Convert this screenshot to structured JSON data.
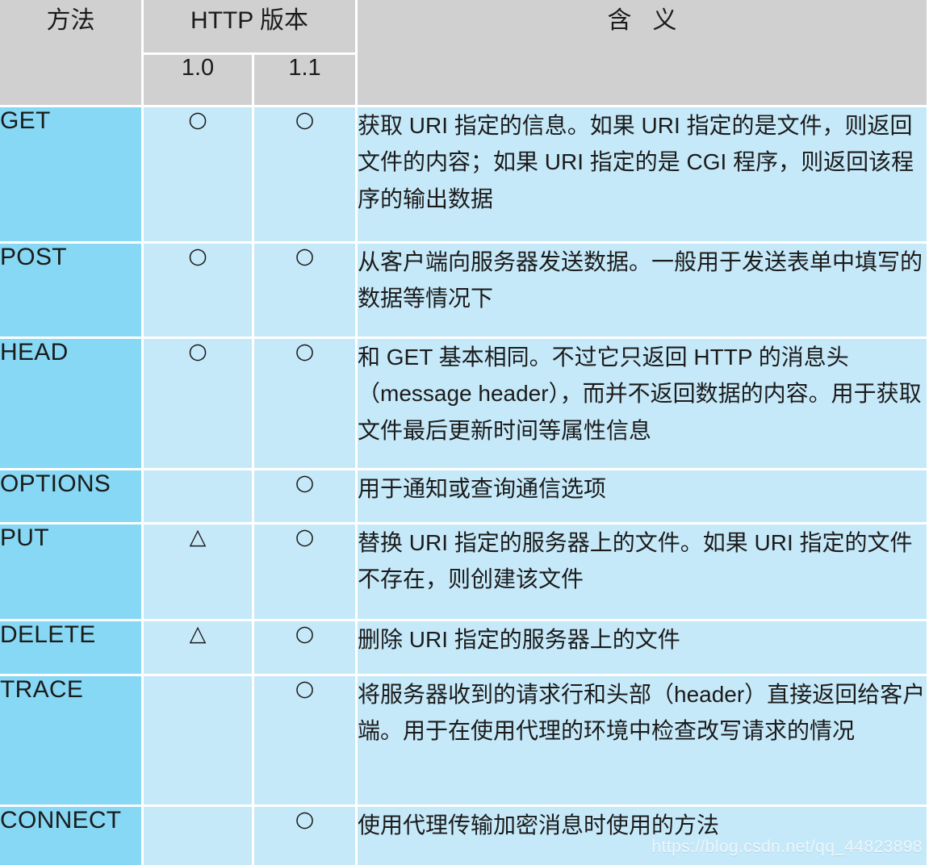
{
  "table": {
    "headers": {
      "method": "方法",
      "version_group": "HTTP 版本",
      "version_1_0": "1.0",
      "version_1_1": "1.1",
      "meaning_char_1": "含",
      "meaning_char_2": "义"
    },
    "symbols": {
      "supported": "○",
      "partial": "△",
      "none": ""
    },
    "rows": [
      {
        "method": "GET",
        "v10": "○",
        "v11": "○",
        "description": "获取 URI 指定的信息。如果 URI 指定的是文件，则返回文件的内容；如果 URI 指定的是 CGI 程序，则返回该程序的输出数据"
      },
      {
        "method": "POST",
        "v10": "○",
        "v11": "○",
        "description": "从客户端向服务器发送数据。一般用于发送表单中填写的数据等情况下"
      },
      {
        "method": "HEAD",
        "v10": "○",
        "v11": "○",
        "description": "和 GET 基本相同。不过它只返回 HTTP 的消息头（message header），而并不返回数据的内容。用于获取文件最后更新时间等属性信息"
      },
      {
        "method": "OPTIONS",
        "v10": "",
        "v11": "○",
        "description": "用于通知或查询通信选项"
      },
      {
        "method": "PUT",
        "v10": "△",
        "v11": "○",
        "description": "替换 URI 指定的服务器上的文件。如果 URI 指定的文件不存在，则创建该文件"
      },
      {
        "method": "DELETE",
        "v10": "△",
        "v11": "○",
        "description": "删除 URI 指定的服务器上的文件"
      },
      {
        "method": "TRACE",
        "v10": "",
        "v11": "○",
        "description": "将服务器收到的请求行和头部（header）直接返回给客户端。用于在使用代理的环境中检查改写请求的情况"
      },
      {
        "method": "CONNECT",
        "v10": "",
        "v11": "○",
        "description": "使用代理传输加密消息时使用的方法"
      }
    ]
  },
  "watermark": {
    "text": "https://blog.csdn.net/qq_44823898"
  },
  "colors": {
    "header_bg": "#d0d0d0",
    "method_bg": "#87d8f5",
    "cell_bg": "#c6e9f9",
    "gridline": "#ffffff",
    "text": "#1b1b1b"
  }
}
